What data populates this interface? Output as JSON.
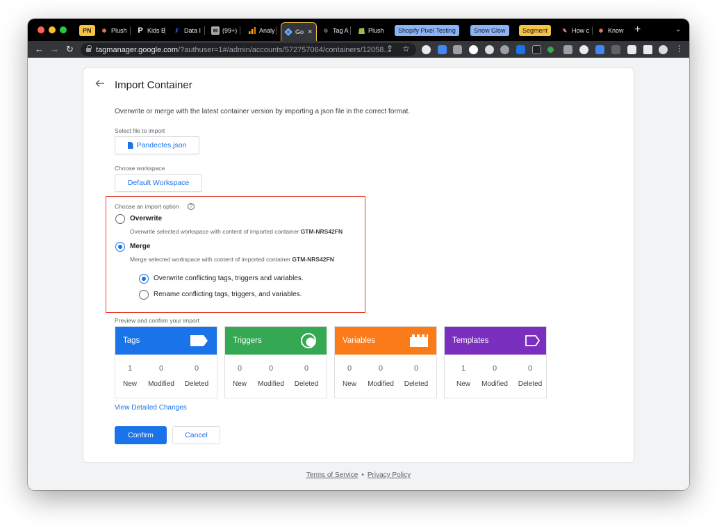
{
  "browser": {
    "tabs": [
      {
        "label": "PN",
        "kind": "pill"
      },
      {
        "label": "Plush"
      },
      {
        "label": "Kids B"
      },
      {
        "label": "Data I"
      },
      {
        "label": "(99+)"
      },
      {
        "label": "Analy"
      },
      {
        "label": "Go",
        "active": true,
        "close": "×"
      },
      {
        "label": "Tag A"
      },
      {
        "label": "Plush"
      },
      {
        "label": "Shopify Pixel Testing",
        "kind": "group"
      },
      {
        "label": "Snow Glow",
        "kind": "group"
      },
      {
        "label": "Segment",
        "kind": "group"
      },
      {
        "label": "How c"
      },
      {
        "label": "Know"
      }
    ],
    "new_tab": "+",
    "tab_menu": "⌄",
    "url_host": "tagmanager.google.com",
    "url_path": "/?authuser=1#/admin/accounts/572757064/containers/12058..."
  },
  "page": {
    "title": "Import Container",
    "description": "Overwrite or merge with the latest container version by importing a json file in the correct format.",
    "file_label": "Select file to import",
    "file_name": "Pandectes.json",
    "workspace_label": "Choose workspace",
    "workspace_name": "Default Workspace",
    "import_option_label": "Choose an import option",
    "help": "?",
    "options": {
      "overwrite": {
        "title": "Overwrite",
        "desc": "Overwrite selected workspace with content of imported container",
        "container": "GTM-NRS42FN",
        "checked": false
      },
      "merge": {
        "title": "Merge",
        "desc": "Merge selected workspace with content of imported container",
        "container": "GTM-NRS42FN",
        "checked": true
      }
    },
    "merge_options": {
      "overwrite_conflicting": "Overwrite conflicting tags, triggers and variables.",
      "rename_conflicting": "Rename conflicting tags, triggers, and variables."
    },
    "preview_label": "Preview and confirm your import",
    "stats": [
      {
        "name": "Tags",
        "color": "#1a73e8",
        "new": "1",
        "modified": "0",
        "deleted": "0"
      },
      {
        "name": "Triggers",
        "color": "#34a853",
        "new": "0",
        "modified": "0",
        "deleted": "0"
      },
      {
        "name": "Variables",
        "color": "#fa7b17",
        "new": "0",
        "modified": "0",
        "deleted": "0"
      },
      {
        "name": "Templates",
        "color": "#7b2fbf",
        "new": "1",
        "modified": "0",
        "deleted": "0"
      }
    ],
    "stat_labels": {
      "new": "New",
      "modified": "Modified",
      "deleted": "Deleted"
    },
    "view_changes": "View Detailed Changes",
    "confirm": "Confirm",
    "cancel": "Cancel"
  },
  "footer": {
    "terms": "Terms of Service",
    "separator": "•",
    "privacy": "Privacy Policy"
  }
}
